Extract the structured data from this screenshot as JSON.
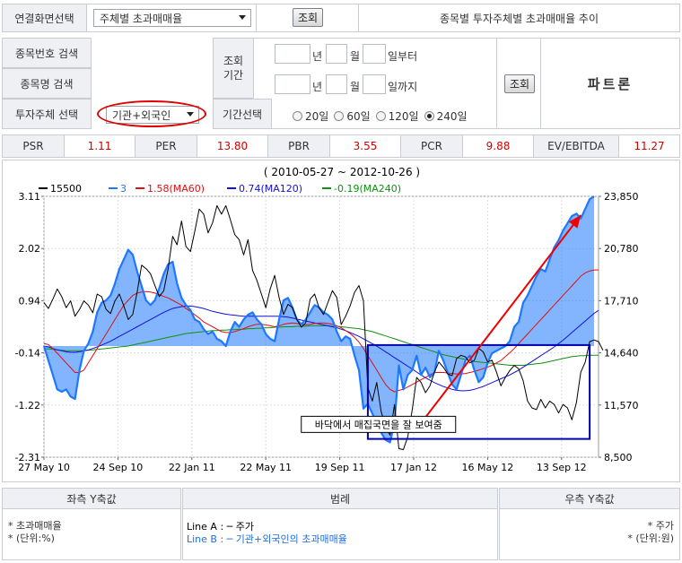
{
  "header": {
    "screen_select_label": "연결화면선택",
    "screen_select_value": "주체별 초과매매율",
    "query_button": "조회",
    "page_title": "종목별 투자주체별 초과매매율 추이"
  },
  "search": {
    "code_label": "종목번호 검색",
    "name_label": "종목명 검색",
    "investor_label": "투자주체 선택",
    "investor_value": "기관+외국인",
    "period_label": "조회\n기간",
    "year_unit": "년",
    "month_unit": "월",
    "from_suffix": "일부터",
    "to_suffix": "일까지",
    "period_select_label": "기간선택",
    "period_options": [
      "20일",
      "60일",
      "120일",
      "240일"
    ],
    "period_selected": "240일",
    "query_button": "조회",
    "stock_name": "파트론"
  },
  "metrics": [
    {
      "label": "PSR",
      "value": "1.11"
    },
    {
      "label": "PER",
      "value": "13.80"
    },
    {
      "label": "PBR",
      "value": "3.55"
    },
    {
      "label": "PCR",
      "value": "9.88"
    },
    {
      "label": "EV/EBITDA",
      "value": "11.27"
    }
  ],
  "colors": {
    "accent_red": "#d00000",
    "price_line": "#000000",
    "excess_fill": "#1e78ff",
    "ma60": "#e01010",
    "ma120": "#1010e0",
    "ma240": "#109010",
    "box": "#0000b0",
    "arrow": "#ee0000"
  },
  "chart_data": {
    "type": "line",
    "title": "( 2010-05-27 ~ 2012-10-26 )",
    "legend": [
      {
        "name": "15500",
        "color": "#000000"
      },
      {
        "name": "3",
        "color": "#1e78ff"
      },
      {
        "name": "1.58(MA60)",
        "color": "#e01010"
      },
      {
        "name": "0.74(MA120)",
        "color": "#1010e0"
      },
      {
        "name": "-0.19(MA240)",
        "color": "#109010"
      }
    ],
    "legend_position": "top",
    "grid": true,
    "x_ticks": [
      "27 May 10",
      "24 Sep 10",
      "22 Jan 11",
      "22 May 11",
      "19 Sep 11",
      "17 Jan 12",
      "16 May 12",
      "13 Sep 12"
    ],
    "y_left_ticks": [
      "3.11",
      "2.02",
      "0.94",
      "-0.14",
      "-1.22",
      "-2.31"
    ],
    "y_left_range": [
      -2.31,
      3.11
    ],
    "y_right_ticks": [
      "23,850",
      "20,780",
      "17,710",
      "14,640",
      "11,570",
      "8,500"
    ],
    "y_right_range": [
      8500,
      23850
    ],
    "x_index_range": [
      0,
      125
    ],
    "series": [
      {
        "name": "15500",
        "axis": "right",
        "color": "#000000",
        "values": [
          17600,
          17250,
          17800,
          18400,
          17950,
          17300,
          17700,
          16800,
          17200,
          17700,
          17450,
          17000,
          18100,
          17950,
          17200,
          16950,
          17700,
          18100,
          17400,
          16600,
          16900,
          18200,
          19800,
          19600,
          19300,
          18600,
          17950,
          18300,
          19600,
          21500,
          21000,
          22400,
          20900,
          20600,
          21800,
          23100,
          22800,
          21700,
          22300,
          23300,
          22800,
          23300,
          22500,
          21600,
          21300,
          20400,
          21300,
          19500,
          18900,
          18100,
          17300,
          18400,
          19200,
          17900,
          16900,
          17500,
          17300,
          16600,
          16150,
          16400,
          17800,
          18100,
          17300,
          16900,
          17600,
          18300,
          17900,
          16300,
          16800,
          17400,
          18200,
          18600,
          17700,
          12600,
          11800,
          12900,
          11200,
          10300,
          9800,
          11600,
          9000,
          8950,
          9700,
          11300,
          13200,
          12900,
          12300,
          12700,
          13500,
          14100,
          13800,
          13400,
          13300,
          14300,
          14500,
          14400,
          14050,
          14200,
          14900,
          14700,
          14100,
          14200,
          13500,
          12700,
          13200,
          13600,
          13900,
          13700,
          13000,
          11800,
          11400,
          11300,
          11900,
          11400,
          11800,
          11600,
          11100,
          11600,
          11400,
          10700,
          11700,
          13500,
          14100,
          15300,
          15400,
          15300,
          14800
        ]
      },
      {
        "name": "3",
        "axis": "left",
        "color": "#1e78ff",
        "values": [
          0.0,
          -0.3,
          -0.6,
          -0.9,
          -0.95,
          -0.9,
          -1.05,
          -1.1,
          -0.5,
          -0.1,
          0.05,
          0.3,
          0.7,
          0.9,
          0.95,
          1.05,
          1.3,
          1.6,
          1.8,
          2.0,
          1.9,
          1.55,
          1.25,
          0.95,
          0.85,
          0.95,
          1.2,
          1.5,
          1.7,
          1.75,
          1.3,
          1.0,
          0.85,
          0.75,
          0.55,
          0.5,
          0.35,
          0.25,
          0.3,
          0.15,
          0.1,
          0.0,
          0.3,
          0.5,
          0.4,
          0.55,
          0.65,
          0.7,
          0.55,
          0.45,
          0.25,
          0.15,
          0.1,
          0.55,
          0.95,
          1.0,
          0.8,
          0.55,
          0.45,
          0.55,
          0.7,
          0.85,
          0.8,
          0.7,
          0.65,
          0.55,
          0.3,
          0.1,
          0.2,
          0.15,
          -0.2,
          -0.5,
          -1.3,
          -1.2,
          -1.4,
          -1.6,
          -1.8,
          -1.95,
          -2.0,
          -1.6,
          -0.4,
          -0.9,
          -0.6,
          -0.5,
          -0.2,
          -0.6,
          -0.45,
          -0.65,
          -0.55,
          -0.1,
          -0.3,
          -0.55,
          -0.8,
          -0.9,
          -0.6,
          -0.3,
          -0.2,
          -0.5,
          -0.75,
          -0.65,
          -0.35,
          -0.15,
          -0.1,
          -0.05,
          0.0,
          0.1,
          0.4,
          0.5,
          0.9,
          1.05,
          1.25,
          1.45,
          1.6,
          1.55,
          1.8,
          2.05,
          2.2,
          2.4,
          2.55,
          2.7,
          2.75,
          2.65,
          2.85,
          3.05,
          3.11
        ]
      },
      {
        "name": "1.58(MA60)",
        "axis": "left",
        "color": "#e01010",
        "values": [
          0.05,
          0.03,
          -0.05,
          -0.15,
          -0.25,
          -0.35,
          -0.45,
          -0.55,
          -0.55,
          -0.5,
          -0.35,
          -0.2,
          -0.05,
          0.1,
          0.25,
          0.4,
          0.55,
          0.7,
          0.85,
          0.95,
          1.05,
          1.1,
          1.12,
          1.13,
          1.12,
          1.1,
          1.07,
          1.03,
          1.0,
          0.95,
          0.9,
          0.85,
          0.78,
          0.72,
          0.65,
          0.58,
          0.5,
          0.45,
          0.4,
          0.35,
          0.3,
          0.28,
          0.28,
          0.3,
          0.33,
          0.36,
          0.4,
          0.43,
          0.45,
          0.45,
          0.44,
          0.42,
          0.4,
          0.42,
          0.45,
          0.47,
          0.48,
          0.47,
          0.45,
          0.44,
          0.45,
          0.47,
          0.48,
          0.48,
          0.47,
          0.45,
          0.42,
          0.38,
          0.32,
          0.26,
          0.18,
          0.08,
          -0.05,
          -0.2,
          -0.35,
          -0.5,
          -0.65,
          -0.8,
          -0.9,
          -0.95,
          -0.92,
          -0.9,
          -0.85,
          -0.8,
          -0.75,
          -0.7,
          -0.65,
          -0.6,
          -0.55,
          -0.55,
          -0.55,
          -0.56,
          -0.57,
          -0.58,
          -0.58,
          -0.57,
          -0.55,
          -0.53,
          -0.5,
          -0.47,
          -0.44,
          -0.4,
          -0.35,
          -0.3,
          -0.22,
          -0.14,
          -0.05,
          0.05,
          0.15,
          0.25,
          0.35,
          0.45,
          0.55,
          0.65,
          0.75,
          0.85,
          0.95,
          1.05,
          1.15,
          1.25,
          1.35,
          1.45,
          1.52,
          1.56,
          1.58,
          1.58
        ]
      },
      {
        "name": "0.74(MA120)",
        "axis": "left",
        "color": "#1010e0",
        "values": [
          0.0,
          -0.02,
          -0.05,
          -0.08,
          -0.1,
          -0.12,
          -0.13,
          -0.13,
          -0.12,
          -0.1,
          -0.08,
          -0.05,
          -0.02,
          0.02,
          0.06,
          0.1,
          0.15,
          0.2,
          0.25,
          0.3,
          0.35,
          0.4,
          0.45,
          0.5,
          0.55,
          0.6,
          0.65,
          0.7,
          0.74,
          0.78,
          0.8,
          0.82,
          0.83,
          0.83,
          0.82,
          0.8,
          0.78,
          0.75,
          0.72,
          0.7,
          0.68,
          0.66,
          0.65,
          0.64,
          0.63,
          0.62,
          0.62,
          0.62,
          0.62,
          0.62,
          0.62,
          0.62,
          0.62,
          0.62,
          0.61,
          0.6,
          0.58,
          0.56,
          0.54,
          0.52,
          0.5,
          0.48,
          0.46,
          0.44,
          0.42,
          0.4,
          0.38,
          0.35,
          0.32,
          0.28,
          0.24,
          0.2,
          0.15,
          0.1,
          0.05,
          0.0,
          -0.06,
          -0.12,
          -0.18,
          -0.24,
          -0.3,
          -0.36,
          -0.42,
          -0.48,
          -0.54,
          -0.6,
          -0.66,
          -0.71,
          -0.76,
          -0.8,
          -0.84,
          -0.87,
          -0.9,
          -0.92,
          -0.93,
          -0.93,
          -0.92,
          -0.9,
          -0.87,
          -0.84,
          -0.8,
          -0.76,
          -0.72,
          -0.68,
          -0.64,
          -0.6,
          -0.55,
          -0.5,
          -0.44,
          -0.38,
          -0.32,
          -0.26,
          -0.2,
          -0.14,
          -0.08,
          -0.02,
          0.05,
          0.12,
          0.2,
          0.28,
          0.36,
          0.44,
          0.52,
          0.6,
          0.68,
          0.74
        ]
      },
      {
        "name": "-0.19(MA240)",
        "axis": "left",
        "color": "#109010",
        "values": [
          -0.05,
          -0.06,
          -0.07,
          -0.08,
          -0.09,
          -0.1,
          -0.1,
          -0.1,
          -0.1,
          -0.1,
          -0.09,
          -0.08,
          -0.07,
          -0.06,
          -0.05,
          -0.04,
          -0.03,
          -0.02,
          -0.01,
          0.0,
          0.02,
          0.04,
          0.06,
          0.08,
          0.1,
          0.12,
          0.14,
          0.16,
          0.18,
          0.2,
          0.22,
          0.24,
          0.26,
          0.27,
          0.28,
          0.29,
          0.3,
          0.31,
          0.32,
          0.32,
          0.33,
          0.33,
          0.34,
          0.34,
          0.35,
          0.35,
          0.36,
          0.36,
          0.37,
          0.37,
          0.38,
          0.38,
          0.39,
          0.39,
          0.4,
          0.4,
          0.4,
          0.41,
          0.41,
          0.41,
          0.42,
          0.42,
          0.42,
          0.42,
          0.42,
          0.41,
          0.41,
          0.4,
          0.39,
          0.38,
          0.37,
          0.36,
          0.34,
          0.32,
          0.3,
          0.27,
          0.24,
          0.21,
          0.18,
          0.15,
          0.12,
          0.09,
          0.06,
          0.03,
          0.0,
          -0.03,
          -0.06,
          -0.09,
          -0.12,
          -0.15,
          -0.18,
          -0.2,
          -0.22,
          -0.24,
          -0.26,
          -0.28,
          -0.3,
          -0.32,
          -0.33,
          -0.34,
          -0.35,
          -0.36,
          -0.37,
          -0.38,
          -0.39,
          -0.4,
          -0.4,
          -0.4,
          -0.4,
          -0.39,
          -0.38,
          -0.37,
          -0.36,
          -0.34,
          -0.32,
          -0.3,
          -0.28,
          -0.26,
          -0.24,
          -0.22,
          -0.21,
          -0.2,
          -0.2,
          -0.19,
          -0.19,
          -0.19
        ]
      }
    ],
    "annotation": "바닥에서 매집국면을 잘 보여줌"
  },
  "footer": {
    "left_title": "좌측 Y축값",
    "left_line1": "* 초과매매율",
    "left_line2": "* (단위:%)",
    "center_title": "범례",
    "legend_a": "Line A : ─ 주가",
    "legend_b": "Line B : ─ 기관+외국인의 초과매매율",
    "right_title": "우측 Y축값",
    "right_line1": "* 주가",
    "right_line2": "* (단위:원)"
  }
}
